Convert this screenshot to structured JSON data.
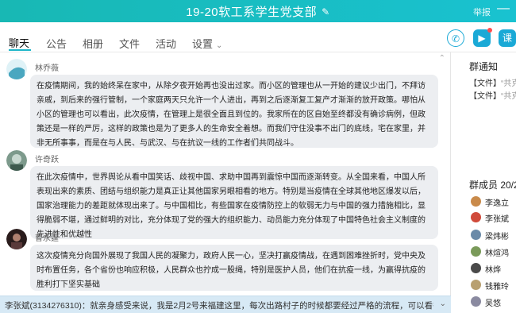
{
  "window": {
    "title": "19-20软工系学生党支部",
    "report": "举报"
  },
  "tabs": [
    {
      "label": "聊天"
    },
    {
      "label": "公告"
    },
    {
      "label": "相册"
    },
    {
      "label": "文件"
    },
    {
      "label": "活动"
    },
    {
      "label": "设置"
    }
  ],
  "toolbar": {
    "icons": [
      "phone-icon",
      "video-icon",
      "class-icon"
    ],
    "class_label": "课"
  },
  "messages": [
    {
      "sender": "林乔薇",
      "avatar_color": "#a6d8e6",
      "text": "在疫情期间，我的始终呆在家中，从除夕夜开始再也没出过家。而小区的管理也从一开始的建议少出门，不拜访亲戚，到后来的强行管制，一个家庭两天只允许一个人进出，再到之后逐渐复工复产才渐渐的放开政策。哪怕从小区的管理也可以看出，此次疫情，在管理上是很全面且到位的。我家所在的区自始至终都没有确诊病例，但政策还是一样的严厉，这样的政策也是为了更多人的生命安全着想。而我们守住没事不出门的底线，宅在家里，并非无所事事，而是在与人民、与武汉、与在抗议一线的工作者们共同战斗。"
    },
    {
      "sender": "许奇跃",
      "avatar_color": "#5a7a6a",
      "text": "在此次疫情中，世界舆论从看中国笑话、歧视中国、求助中国再到震惊中国而逐渐转变。从全国来看，中国人所表现出来的素质、团结与组织能力是真正让其他国家另眼相看的地方。特别是当疫情在全球其他地区爆发以后，国家治理能力的差距就体现出来了。与中国相比，有些国家在疫情防控上的软弱无力与中国的强力措施相比，显得脆弱不堪，通过鲜明的对比，充分体现了党的强大的组织能力、动员能力充分体现了中国特色社会主义制度的先进性和优越性"
    },
    {
      "sender": "曹永霆",
      "avatar_color": "#3a2a2a",
      "text": "这次疫情充分向国外展现了我国人民的凝聚力，政府人民一心，坚决打赢疫情战，在遇到困难挫折时，党中央及时布置任务，各个省份也响应积极，人民群众也拧成一股绳，特别是医护人员，他们在抗疫一线，为赢得抗疫的胜利打下坚实基础"
    }
  ],
  "bottom_message": "李张斌(3134276310)：就亲身感受来说，我是2月2号来福建这里，每次出路村子的时候都要经过严格的流程，可以看得出来我身...",
  "group_notice": {
    "header": "群通知",
    "items": [
      {
        "tag": "【文件】",
        "text": "“共克"
      },
      {
        "tag": "【文件】",
        "text": "“共克"
      }
    ]
  },
  "members": {
    "header": "群成员 20/2",
    "list": [
      {
        "name": "李逸立",
        "color": "#c98a4a"
      },
      {
        "name": "李张斌",
        "color": "#d04a3a"
      },
      {
        "name": "梁炜彬",
        "color": "#6a8aa8"
      },
      {
        "name": "林煊鸿",
        "color": "#7a9a5a"
      },
      {
        "name": "林烨",
        "color": "#4a4a4a"
      },
      {
        "name": "钱雅玲",
        "color": "#b8a070"
      },
      {
        "name": "吴悠",
        "color": "#8a8aa0"
      }
    ]
  }
}
